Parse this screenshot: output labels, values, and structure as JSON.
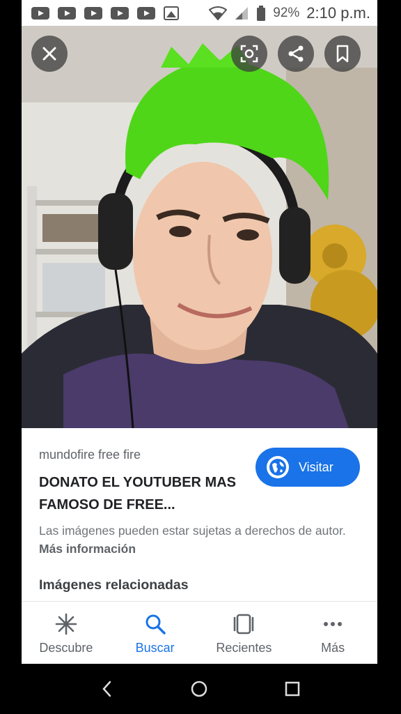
{
  "status_bar": {
    "battery": "92%",
    "time": "2:10 p.m.",
    "notification_icons": [
      "youtube-icon",
      "youtube-icon",
      "youtube-icon",
      "youtube-icon",
      "youtube-icon",
      "gallery-icon"
    ]
  },
  "viewer": {
    "buttons": [
      "close-icon",
      "lens-icon",
      "share-icon",
      "bookmark-icon"
    ],
    "image_description_only_visual": true
  },
  "result": {
    "source": "mundofire free fire",
    "title": "DONATO EL YOUTUBER MAS FAMOSO DE FREE...",
    "visit_label": "Visitar",
    "rights_text": "Las imágenes pueden estar sujetas a derechos de autor.",
    "more_info": "Más información",
    "related_heading": "Imágenes relacionadas"
  },
  "bottom_nav": {
    "items": [
      {
        "label": "Descubre",
        "icon": "asterisk-icon",
        "active": false
      },
      {
        "label": "Buscar",
        "icon": "search-icon",
        "active": true
      },
      {
        "label": "Recientes",
        "icon": "recent-icon",
        "active": false
      },
      {
        "label": "Más",
        "icon": "more-icon",
        "active": false
      }
    ]
  },
  "colors": {
    "accent": "#1a73e8",
    "text_dark": "#202124",
    "text_muted": "#70757a"
  }
}
